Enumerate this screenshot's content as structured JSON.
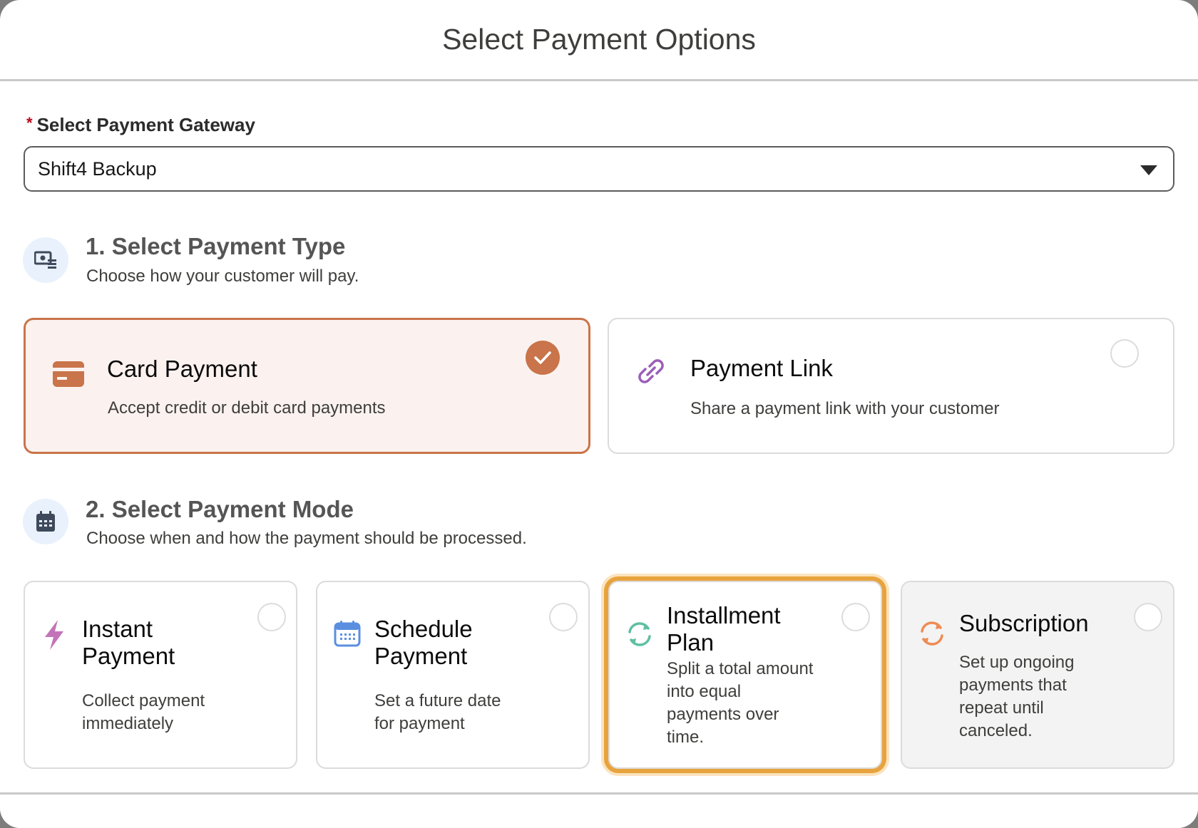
{
  "modal": {
    "title": "Select Payment Options"
  },
  "gateway": {
    "required_mark": "*",
    "label": "Select Payment Gateway",
    "selected_value": "Shift4 Backup"
  },
  "payment_type_section": {
    "title": "1. Select Payment Type",
    "subtitle": "Choose how your customer will pay.",
    "options": [
      {
        "title": "Card Payment",
        "description": "Accept credit or debit card payments",
        "selected": true
      },
      {
        "title": "Payment Link",
        "description": "Share a payment link with your customer",
        "selected": false
      }
    ]
  },
  "payment_mode_section": {
    "title": "2. Select Payment Mode",
    "subtitle": "Choose when and how the payment should be processed.",
    "options": [
      {
        "title_line1": "Instant",
        "title_line2": "Payment",
        "desc_line1": "Collect payment",
        "desc_line2": "immediately",
        "selected": false
      },
      {
        "title_line1": "Schedule",
        "title_line2": "Payment",
        "desc_line1": "Set a future date",
        "desc_line2": "for payment",
        "selected": false
      },
      {
        "title_line1": "Installment",
        "title_line2": "Plan",
        "desc_line1": "Split a total amount",
        "desc_line2": "into equal",
        "desc_line3": "payments over",
        "desc_line4": "time.",
        "selected": false,
        "focused": true
      },
      {
        "title": "Subscription",
        "desc_line1": "Set up ongoing",
        "desc_line2": "payments that",
        "desc_line3": "repeat until",
        "desc_line4": "canceled.",
        "selected": false,
        "disabled": true
      }
    ]
  },
  "colors": {
    "accent": "#c9744a",
    "focus_ring": "#e8a33d",
    "instant_icon": "#c374b8",
    "schedule_icon": "#5a8fe0",
    "installment_icon": "#5fbfa3",
    "subscription_icon": "#ee8c55",
    "link_icon": "#9b5fb8"
  },
  "icons": {
    "gateway_caret": "chevron-down-icon",
    "payment_type": "money-icon",
    "payment_mode": "calendar-icon",
    "card_payment": "credit-card-icon",
    "payment_link": "link-icon",
    "instant": "lightning-icon",
    "schedule": "calendar-icon",
    "installment": "refresh-icon",
    "subscription": "refresh-icon",
    "selected": "check-icon"
  }
}
